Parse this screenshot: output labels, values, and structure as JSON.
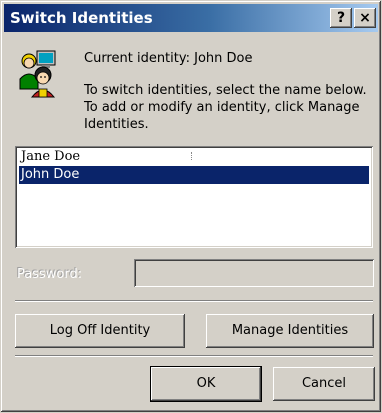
{
  "window": {
    "title": "Switch Identities",
    "help_glyph": "?",
    "close_glyph": "×"
  },
  "current_identity_text": "Current identity: John Doe",
  "instructions": "To switch identities, select the name below. To add or modify an identity, click Manage Identities.",
  "identities": [
    {
      "name": "Jane Doe",
      "selected": false
    },
    {
      "name": "John Doe",
      "selected": true
    }
  ],
  "password": {
    "label": "Password:",
    "value": ""
  },
  "buttons": {
    "log_off": "Log Off Identity",
    "manage": "Manage Identities",
    "ok": "OK",
    "cancel": "Cancel"
  },
  "icons": {
    "identity": "identity-users-icon"
  },
  "colors": {
    "title_start": "#0a246a",
    "title_end": "#a6caf0",
    "selection": "#0a246a",
    "dialog": "#d4d0c8"
  }
}
